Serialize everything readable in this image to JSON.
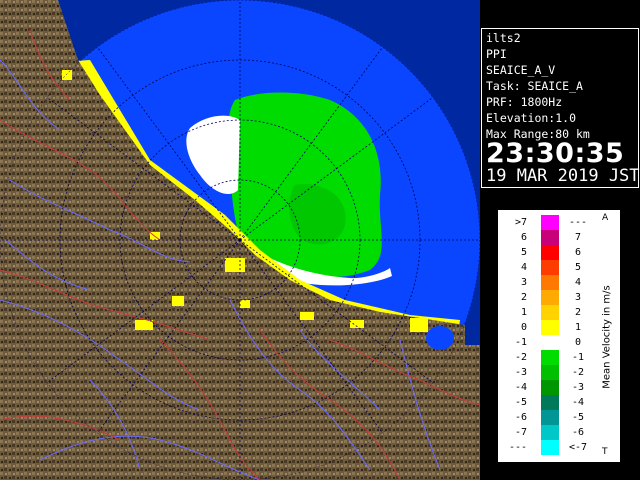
{
  "info": {
    "site": "ilts2",
    "product": "PPI",
    "product_name": "SEAICE_A_V",
    "task": "Task: SEAICE_A",
    "prf": "PRF: 1800Hz",
    "elevation": "Elevation:1.0",
    "max_range": "Max Range:80 km",
    "time": "23:30:35",
    "date": "19 MAR 2019 JST"
  },
  "legend": {
    "title": "Mean Velocity in m/s",
    "top_mark": "A",
    "bottom_mark": "T",
    "rows": [
      {
        "left": ">7",
        "right": "---",
        "color": "#ff00ff"
      },
      {
        "left": "6",
        "right": "7",
        "color": "#c8007a"
      },
      {
        "left": "5",
        "right": "6",
        "color": "#ff0000"
      },
      {
        "left": "4",
        "right": "5",
        "color": "#ff3c00"
      },
      {
        "left": "3",
        "right": "4",
        "color": "#ff7800"
      },
      {
        "left": "2",
        "right": "3",
        "color": "#ffaa00"
      },
      {
        "left": "1",
        "right": "2",
        "color": "#ffd200"
      },
      {
        "left": "0",
        "right": "1",
        "color": "#ffff00"
      },
      {
        "left": "-1",
        "right": "0",
        "color": "#ffffff"
      },
      {
        "left": "-2",
        "right": "-1",
        "color": "#00dc00"
      },
      {
        "left": "-3",
        "right": "-2",
        "color": "#00be00"
      },
      {
        "left": "-4",
        "right": "-3",
        "color": "#009600"
      },
      {
        "left": "-5",
        "right": "-4",
        "color": "#00785a"
      },
      {
        "left": "-6",
        "right": "-5",
        "color": "#009696"
      },
      {
        "left": "-7",
        "right": "-6",
        "color": "#00c8c8"
      },
      {
        "left": "---",
        "right": "<-7",
        "color": "#00ffff"
      }
    ]
  },
  "map": {
    "sea_color": "#0a46ff",
    "out_of_range_color": "#0028a0",
    "land_color": "#6e5a3c"
  }
}
